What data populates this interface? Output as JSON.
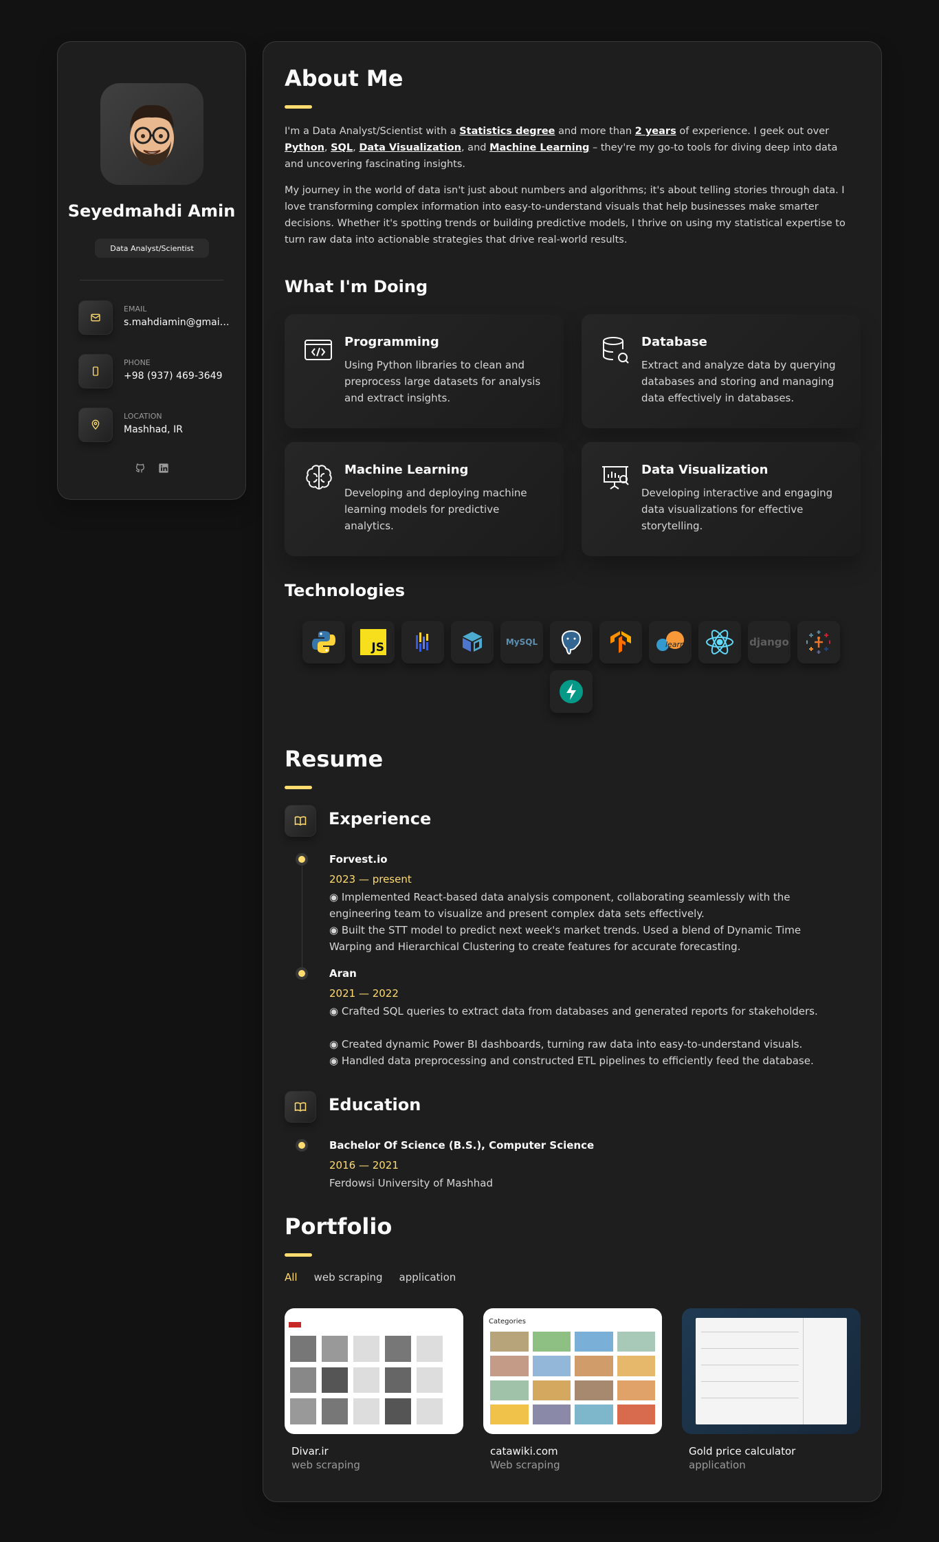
{
  "profile": {
    "name": "Seyedmahdi Amin",
    "title": "Data Analyst/Scientist",
    "contacts": [
      {
        "label": "EMAIL",
        "value": "s.mahdiamin@gmail.com",
        "icon": "mail-icon"
      },
      {
        "label": "PHONE",
        "value": "+98 (937) 469-3649",
        "icon": "phone-icon"
      },
      {
        "label": "LOCATION",
        "value": "Mashhad, IR",
        "icon": "location-icon"
      }
    ],
    "socials": [
      "github-icon",
      "linkedin-icon"
    ]
  },
  "about": {
    "heading": "About Me",
    "p1": {
      "t1": "I'm a Data Analyst/Scientist with a ",
      "b1": "Statistics degree",
      "t2": " and more than ",
      "b2": "2 years",
      "t3": " of experience. I geek out over ",
      "b3": "Python",
      "t4": ", ",
      "b4": "SQL",
      "t5": ", ",
      "b5": "Data Visualization",
      "t6": ", and ",
      "b6": "Machine Learning",
      "t7": " – they're my go-to tools for diving deep into data and uncovering fascinating insights."
    },
    "p2": "My journey in the world of data isn't just about numbers and algorithms; it's about telling stories through data. I love transforming complex information into easy-to-understand visuals that help businesses make smarter decisions. Whether it's spotting trends or building predictive models, I thrive on using my statistical expertise to turn raw data into actionable strategies that drive real-world results."
  },
  "doing": {
    "heading": "What I'm Doing",
    "services": [
      {
        "title": "Programming",
        "desc": "Using Python libraries to clean and preprocess large datasets for analysis and extract insights."
      },
      {
        "title": "Database",
        "desc": "Extract and analyze data by querying databases and storing and managing data effectively in databases."
      },
      {
        "title": "Machine Learning",
        "desc": "Developing and deploying machine learning models for predictive analytics."
      },
      {
        "title": "Data Visualization",
        "desc": "Developing interactive and engaging data visualizations for effective storytelling."
      }
    ]
  },
  "technologies": {
    "heading": "Technologies",
    "items": [
      "python-icon",
      "javascript-icon",
      "polars-icon",
      "numpy-icon",
      "mysql-icon",
      "postgresql-icon",
      "tensorflow-icon",
      "scikit-learn-icon",
      "react-icon",
      "django-icon",
      "tableau-icon",
      "fastapi-icon"
    ],
    "labels": {
      "js": "JS",
      "mysql": "MySQL",
      "sklearn": "learn",
      "django": "django"
    }
  },
  "resume": {
    "heading": "Resume",
    "experience": {
      "heading": "Experience",
      "items": [
        {
          "company": "Forvest.io",
          "date": "2023 — present",
          "bullets": [
            "◉ Implemented React-based data analysis component, collaborating seamlessly with the engineering team to visualize and present complex data sets effectively.",
            "◉ Built the STT model to predict next week's market trends. Used a blend of Dynamic Time Warping and Hierarchical Clustering to create features for accurate forecasting."
          ]
        },
        {
          "company": "Aran",
          "date": "2021 — 2022",
          "bullets": [
            "◉ Crafted SQL queries to extract data from databases and generated reports for stakeholders.",
            "◉ Created dynamic Power BI dashboards, turning raw data into easy-to-understand visuals.",
            "◉ Handled data preprocessing and constructed ETL pipelines to efficiently feed the database."
          ]
        }
      ]
    },
    "education": {
      "heading": "Education",
      "items": [
        {
          "degree": "Bachelor Of Science (B.S.), Computer Science",
          "date": "2016 — 2021",
          "school": "Ferdowsi University of Mashhad"
        }
      ]
    }
  },
  "portfolio": {
    "heading": "Portfolio",
    "filters": [
      "All",
      "web scraping",
      "application"
    ],
    "active_filter": "All",
    "projects": [
      {
        "title": "Divar.ir",
        "category": "web scraping"
      },
      {
        "title": "catawiki.com",
        "category": "Web scraping",
        "thumb_heading": "Categories"
      },
      {
        "title": "Gold price calculator",
        "category": "application"
      }
    ]
  },
  "colors": {
    "accent": "#ffdb70",
    "background": "#121212",
    "card": "#1e1e1f"
  }
}
